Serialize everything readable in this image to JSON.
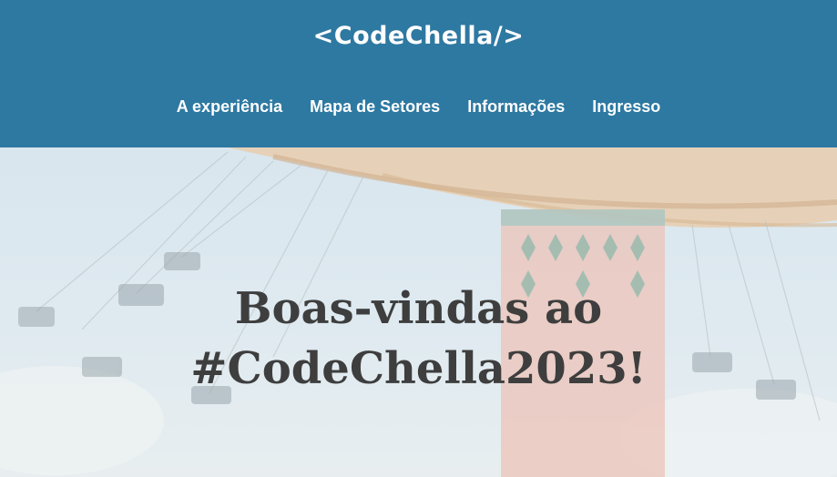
{
  "header": {
    "logo": "<CodeChella/>",
    "nav": [
      {
        "label": "A experiência"
      },
      {
        "label": "Mapa de Setores"
      },
      {
        "label": "Informações"
      },
      {
        "label": "Ingresso"
      }
    ]
  },
  "hero": {
    "title": "Boas-vindas ao\n#CodeChella2023!"
  },
  "colors": {
    "header_bg": "#2e79a2",
    "nav_text": "#ffffff",
    "title_text": "#3e3e3e"
  }
}
